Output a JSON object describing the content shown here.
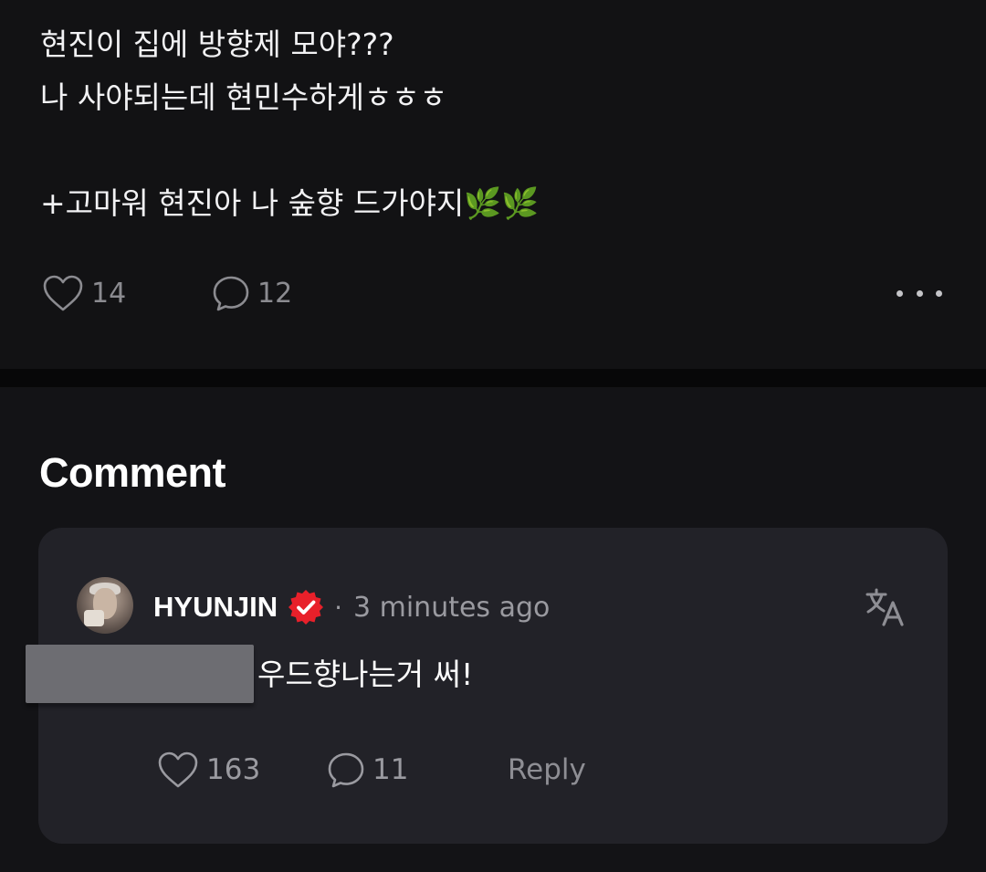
{
  "post": {
    "text": "현진이 집에 방향제 모야???\n나 사야되는데 현민수하게ㅎㅎㅎ\n\n+고마워 현진아 나 숲향 드가야지🌿🌿",
    "like_count": "14",
    "comment_count": "12",
    "icons": {
      "like": "heart-icon",
      "comment": "speech-bubble-icon",
      "more": "more-dots-icon"
    }
  },
  "comments_section": {
    "title": "Comment",
    "items": [
      {
        "author": "HYUNJIN",
        "verified": true,
        "separator": "·",
        "timestamp": "3 minutes ago",
        "body": "우드향나는거 써!",
        "like_count": "163",
        "reply_count": "11",
        "reply_label": "Reply",
        "icons": {
          "translate": "translate-icon",
          "verified": "verified-badge-icon",
          "like": "heart-icon",
          "comment": "speech-bubble-icon"
        }
      }
    ]
  },
  "colors": {
    "background": "#101012",
    "card": "#222228",
    "verified_badge": "#e8202a",
    "muted_text": "#9a9aa0",
    "primary_text": "#ffffff"
  }
}
